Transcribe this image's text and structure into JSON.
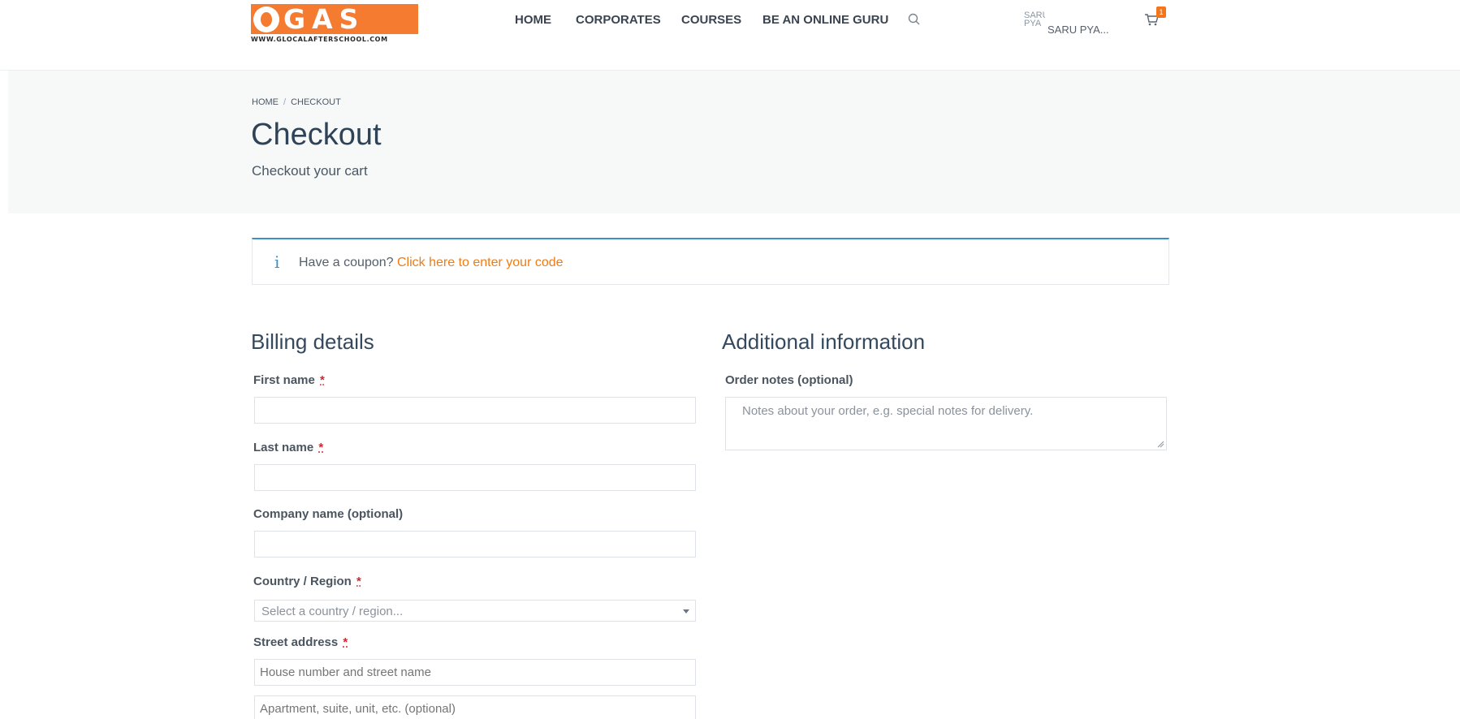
{
  "logo": {
    "text": "GAS",
    "url_text": "WWW.GLOCALAFTERSCHOOL.COM"
  },
  "nav": {
    "items": [
      {
        "label": "HOME"
      },
      {
        "label": "CORPORATES"
      },
      {
        "label": "COURSES"
      },
      {
        "label": "BE AN ONLINE GURU"
      }
    ],
    "search_icon": "search-icon"
  },
  "user": {
    "avatar_alt": "SARU PYA",
    "name": "SARU PYA..."
  },
  "cart": {
    "icon": "cart-icon",
    "count": "1"
  },
  "breadcrumb": {
    "home": "HOME",
    "separator": "/",
    "current": "CHECKOUT"
  },
  "page": {
    "title": "Checkout",
    "subtitle": "Checkout your cart"
  },
  "coupon": {
    "icon": "info-icon",
    "text": "Have a coupon?",
    "link": "Click here to enter your code"
  },
  "billing": {
    "title": "Billing details",
    "first_name_label": "First name",
    "last_name_label": "Last name",
    "company_label": "Company name (optional)",
    "country_label": "Country / Region",
    "country_placeholder": "Select a country / region...",
    "street_label": "Street address",
    "street_placeholder": "House number and street name",
    "apartment_placeholder": "Apartment, suite, unit, etc. (optional)",
    "required_mark": "*"
  },
  "additional": {
    "title": "Additional information",
    "order_notes_label": "Order notes (optional)",
    "order_notes_placeholder": "Notes about your order, e.g. special notes for delivery."
  },
  "colors": {
    "accent": "#f07c13",
    "logo_orange": "#f47b30",
    "info_blue": "#3b8fc2",
    "heading": "#2f4358",
    "required": "#d3262f"
  }
}
